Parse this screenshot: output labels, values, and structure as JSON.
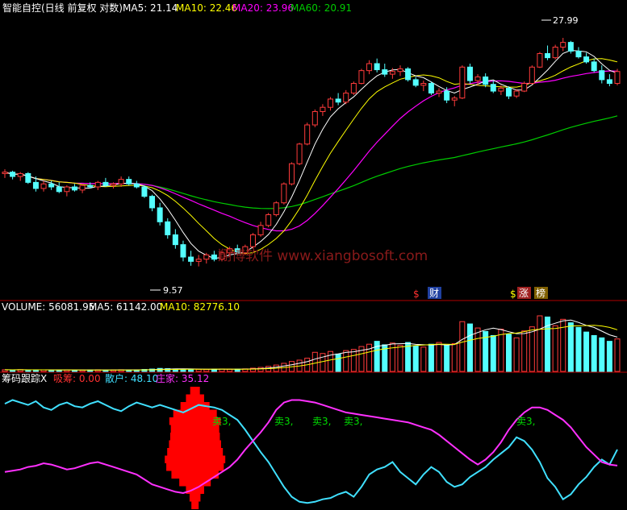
{
  "header": {
    "title": "智能自控(日线 前复权 对数)",
    "ma5": "MA5: 21.14",
    "ma10": "MA10: 22.46",
    "ma20": "MA20: 23.96",
    "ma60": "MA60: 20.91"
  },
  "price_panel": {
    "high_label": "27.99",
    "low_label": "9.57",
    "watermark": "翔博软件 www.xiangbosoft.com",
    "marks": [
      "$",
      "财",
      "$",
      "涨",
      "榜"
    ]
  },
  "volume_panel": {
    "title": "VOLUME: 56081.95",
    "ma5": "MA5: 61142.00",
    "ma10": "MA10: 82776.10"
  },
  "chip_panel": {
    "title": "筹码跟踪X",
    "xichou": "吸筹: 0.00",
    "sanhu": "散户: 48.10",
    "zhuangjia": "庄家: 35.12",
    "sell_labels": [
      "卖3,",
      "卖3,",
      "卖3,",
      "卖3,",
      "卖3,"
    ]
  },
  "colors": {
    "up": "#ff3b3b",
    "down": "#54ffff",
    "ma5": "#ffffff",
    "ma10": "#ffff00",
    "ma20": "#ff00ff",
    "ma60": "#00cc00",
    "sanhu": "#40e0ff",
    "zhuangjia": "#ff30ff",
    "chip": "#ff0000"
  },
  "chart_data": {
    "type": "line",
    "price_scale": "log",
    "ylim": [
      8.5,
      31
    ],
    "candles": [
      [
        14.8,
        15.1,
        14.5,
        14.9
      ],
      [
        14.9,
        15.0,
        14.4,
        14.6
      ],
      [
        14.6,
        14.9,
        14.3,
        14.8
      ],
      [
        14.8,
        14.9,
        14.1,
        14.2
      ],
      [
        14.2,
        14.6,
        13.6,
        13.8
      ],
      [
        13.8,
        14.3,
        13.6,
        14.1
      ],
      [
        14.1,
        14.3,
        13.7,
        13.9
      ],
      [
        13.9,
        14.2,
        13.5,
        13.6
      ],
      [
        13.6,
        14.0,
        13.3,
        13.9
      ],
      [
        13.9,
        14.1,
        13.6,
        13.7
      ],
      [
        13.7,
        14.1,
        13.5,
        14.0
      ],
      [
        14.0,
        14.2,
        13.8,
        13.9
      ],
      [
        13.9,
        14.3,
        13.7,
        14.2
      ],
      [
        14.2,
        14.5,
        13.9,
        14.0
      ],
      [
        14.0,
        14.2,
        13.8,
        14.1
      ],
      [
        14.1,
        14.6,
        13.9,
        14.4
      ],
      [
        14.4,
        14.6,
        14.0,
        14.1
      ],
      [
        14.1,
        14.3,
        13.8,
        13.9
      ],
      [
        13.9,
        14.0,
        13.2,
        13.3
      ],
      [
        13.3,
        13.4,
        12.4,
        12.6
      ],
      [
        12.6,
        12.9,
        11.6,
        11.8
      ],
      [
        11.8,
        12.0,
        10.9,
        11.1
      ],
      [
        11.1,
        11.4,
        10.4,
        10.6
      ],
      [
        10.6,
        10.8,
        9.8,
        10.0
      ],
      [
        10.0,
        10.3,
        9.6,
        9.8
      ],
      [
        9.8,
        10.1,
        9.57,
        9.9
      ],
      [
        9.9,
        10.2,
        9.7,
        10.1
      ],
      [
        10.1,
        10.3,
        9.8,
        9.9
      ],
      [
        9.9,
        10.3,
        9.8,
        10.2
      ],
      [
        10.2,
        10.5,
        10.0,
        10.4
      ],
      [
        10.4,
        10.6,
        10.1,
        10.2
      ],
      [
        10.2,
        10.6,
        10.1,
        10.5
      ],
      [
        10.5,
        11.2,
        10.4,
        11.1
      ],
      [
        11.1,
        11.8,
        11.0,
        11.6
      ],
      [
        11.6,
        12.3,
        11.5,
        12.2
      ],
      [
        12.2,
        13.0,
        12.1,
        12.9
      ],
      [
        12.9,
        14.2,
        12.8,
        14.1
      ],
      [
        14.1,
        15.6,
        14.0,
        15.5
      ],
      [
        15.5,
        17.1,
        15.4,
        17.0
      ],
      [
        17.0,
        18.8,
        16.9,
        18.6
      ],
      [
        18.6,
        20.0,
        18.4,
        19.8
      ],
      [
        19.8,
        20.5,
        19.4,
        20.2
      ],
      [
        20.2,
        21.2,
        19.9,
        21.0
      ],
      [
        21.0,
        21.6,
        20.4,
        20.7
      ],
      [
        20.7,
        21.9,
        20.5,
        21.6
      ],
      [
        21.6,
        22.8,
        21.4,
        22.6
      ],
      [
        22.6,
        24.2,
        22.5,
        24.0
      ],
      [
        24.0,
        25.2,
        23.6,
        24.8
      ],
      [
        24.8,
        25.4,
        23.8,
        24.1
      ],
      [
        24.1,
        24.8,
        23.3,
        23.6
      ],
      [
        23.6,
        24.3,
        23.1,
        23.9
      ],
      [
        23.9,
        24.6,
        23.4,
        24.2
      ],
      [
        24.2,
        24.4,
        22.8,
        23.0
      ],
      [
        23.0,
        23.3,
        22.2,
        22.4
      ],
      [
        22.4,
        22.9,
        21.8,
        22.6
      ],
      [
        22.6,
        22.8,
        21.4,
        21.6
      ],
      [
        21.6,
        22.1,
        21.2,
        21.8
      ],
      [
        21.8,
        22.2,
        20.6,
        20.9
      ],
      [
        20.9,
        21.3,
        20.3,
        21.1
      ],
      [
        21.1,
        24.6,
        21.0,
        24.4
      ],
      [
        24.4,
        24.8,
        22.6,
        22.9
      ],
      [
        22.9,
        23.6,
        22.4,
        23.3
      ],
      [
        23.3,
        23.7,
        22.2,
        22.5
      ],
      [
        22.5,
        22.9,
        21.6,
        21.8
      ],
      [
        21.8,
        22.4,
        21.4,
        22.1
      ],
      [
        22.1,
        22.3,
        21.0,
        21.3
      ],
      [
        21.3,
        22.0,
        21.1,
        21.8
      ],
      [
        21.8,
        22.8,
        21.7,
        22.6
      ],
      [
        22.6,
        24.6,
        22.5,
        24.4
      ],
      [
        24.4,
        26.2,
        24.3,
        26.0
      ],
      [
        26.0,
        27.0,
        25.2,
        25.5
      ],
      [
        25.5,
        27.1,
        25.3,
        26.8
      ],
      [
        26.8,
        27.99,
        26.3,
        27.4
      ],
      [
        27.4,
        27.6,
        26.0,
        26.3
      ],
      [
        26.3,
        26.8,
        25.4,
        25.6
      ],
      [
        25.6,
        26.1,
        24.8,
        25.0
      ],
      [
        25.0,
        25.4,
        23.8,
        24.0
      ],
      [
        24.0,
        24.6,
        22.6,
        23.0
      ],
      [
        23.0,
        23.6,
        22.3,
        22.6
      ],
      [
        22.6,
        24.2,
        22.4,
        23.9
      ]
    ],
    "volume": [
      2900,
      2600,
      3100,
      2400,
      2800,
      2700,
      2300,
      2500,
      2600,
      2200,
      2400,
      2500,
      2800,
      2300,
      2600,
      2900,
      2500,
      2700,
      3400,
      4100,
      5200,
      4800,
      4300,
      3600,
      4000,
      3500,
      3300,
      3900,
      4200,
      3700,
      3900,
      4400,
      5600,
      6900,
      8800,
      11000,
      14000,
      17200,
      19500,
      22800,
      33000,
      31000,
      34500,
      30000,
      36000,
      38000,
      43000,
      47000,
      52000,
      46000,
      49000,
      45000,
      50000,
      44000,
      42000,
      47000,
      50000,
      45000,
      48000,
      86000,
      82000,
      75000,
      69000,
      62000,
      73000,
      64000,
      58000,
      70000,
      77000,
      96000,
      94000,
      79000,
      90000,
      84000,
      76000,
      68000,
      62000,
      58000,
      52000,
      56081.95
    ],
    "chip_profile": {
      "center": 11,
      "levels": [
        10.0,
        10.2,
        10.4,
        10.6,
        10.8,
        11.0,
        11.2,
        11.4,
        11.6,
        11.8,
        12.0,
        12.2,
        12.4,
        12.6,
        12.8,
        13.0
      ],
      "weights": [
        0.12,
        0.18,
        0.3,
        0.52,
        0.78,
        0.95,
        1.0,
        0.92,
        0.86,
        0.82,
        0.8,
        0.85,
        0.72,
        0.48,
        0.3,
        0.16
      ]
    },
    "sanhu": [
      85,
      88,
      86,
      84,
      87,
      82,
      80,
      84,
      86,
      83,
      82,
      85,
      87,
      84,
      81,
      79,
      83,
      86,
      84,
      82,
      84,
      82,
      80,
      78,
      81,
      84,
      83,
      82,
      80,
      76,
      72,
      64,
      55,
      46,
      38,
      28,
      18,
      10,
      6,
      5,
      6,
      8,
      9,
      12,
      14,
      10,
      18,
      28,
      32,
      34,
      38,
      30,
      25,
      20,
      28,
      34,
      30,
      22,
      18,
      20,
      26,
      30,
      34,
      40,
      45,
      50,
      58,
      55,
      48,
      38,
      25,
      18,
      8,
      12,
      20,
      26,
      34,
      40,
      36,
      48.1
    ],
    "zhuangjia": [
      30,
      31,
      32,
      34,
      35,
      37,
      36,
      34,
      32,
      33,
      35,
      37,
      38,
      36,
      34,
      32,
      30,
      28,
      24,
      20,
      18,
      16,
      14,
      13,
      15,
      18,
      22,
      26,
      30,
      34,
      40,
      48,
      55,
      62,
      70,
      80,
      86,
      88,
      88,
      87,
      86,
      84,
      82,
      80,
      78,
      77,
      76,
      75,
      74,
      73,
      72,
      71,
      70,
      68,
      66,
      64,
      60,
      55,
      50,
      45,
      40,
      36,
      40,
      46,
      54,
      64,
      72,
      78,
      82,
      82,
      80,
      76,
      72,
      66,
      58,
      50,
      44,
      38,
      36,
      35.12
    ]
  }
}
